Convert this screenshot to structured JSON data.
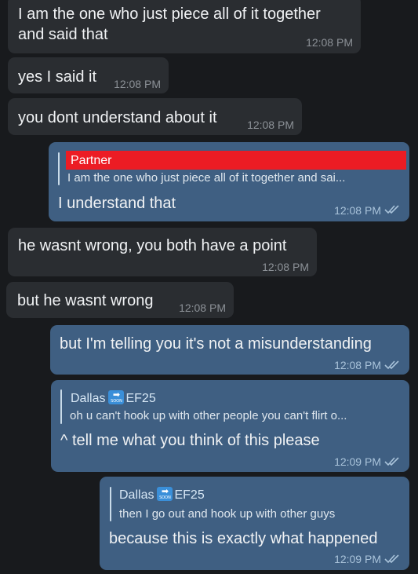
{
  "messages": [
    {
      "text_lines": [
        "I am the one who just piece all of it together",
        "and said that"
      ],
      "time": "12:08 PM"
    },
    {
      "text": "yes I said it",
      "time": "12:08 PM"
    },
    {
      "text": "you dont understand about it",
      "time": "12:08 PM"
    },
    {
      "reply_name": "Partner",
      "reply_text": "I am the one who just piece all of it together and sai...",
      "text": "I understand that",
      "time": "12:08 PM"
    },
    {
      "text": "he wasnt wrong, you both have a point",
      "time": "12:08 PM"
    },
    {
      "text": "but he wasnt wrong",
      "time": "12:08 PM"
    },
    {
      "text": "but I'm telling you it's not a misunderstanding",
      "time": "12:08 PM"
    },
    {
      "reply_name": "Dallas",
      "reply_name_suffix": "EF25",
      "reply_text": "oh u can't hook up with other people you can't flirt o...",
      "text": "^ tell me what you think of this please",
      "time": "12:09 PM"
    },
    {
      "reply_name": "Dallas",
      "reply_name_suffix": "EF25",
      "reply_text": "then I go out and hook up with other guys",
      "text": "because this is exactly what happened",
      "time": "12:09 PM"
    }
  ],
  "icons": {
    "emoji_arrow": "➡",
    "emoji_soon": "SOON",
    "read_ticks": "double-check-icon"
  },
  "colors": {
    "incoming_bubble": "#2a2d31",
    "outgoing_bubble": "#3f5f82",
    "redaction_red": "#ec1c24"
  }
}
